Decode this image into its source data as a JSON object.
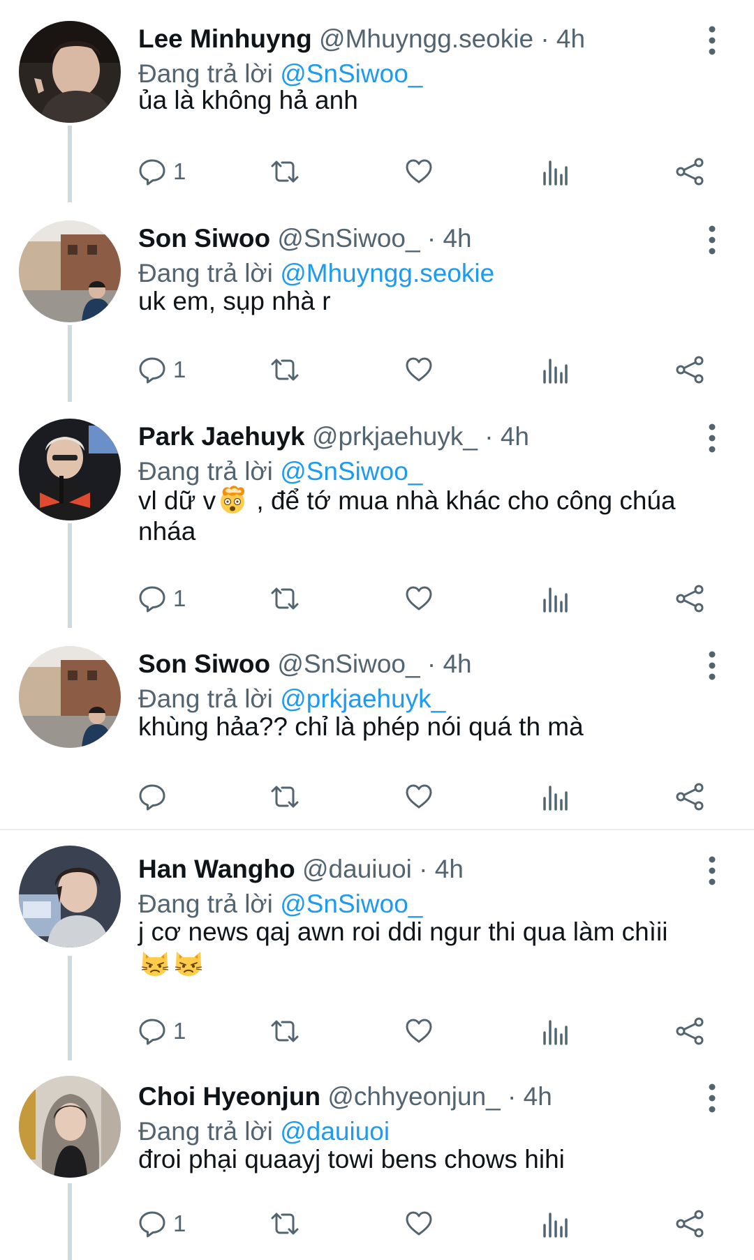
{
  "separator": "·",
  "tweets": [
    {
      "display_name": "Lee Minhuyng",
      "handle": "@Mhuyngg.seokie",
      "time": "4h",
      "replying_label": "Đang trả lời",
      "replying_to": "@SnSiwoo_",
      "text": "ủa là không hả anh",
      "reply_count": "1"
    },
    {
      "display_name": "Son Siwoo",
      "handle": "@SnSiwoo_",
      "time": "4h",
      "replying_label": "Đang trả lời",
      "replying_to": "@Mhuyngg.seokie",
      "text": "uk em, sụp nhà r",
      "reply_count": "1"
    },
    {
      "display_name": "Park Jaehuyk",
      "handle": "@prkjaehuyk_",
      "time": "4h",
      "replying_label": "Đang trả lời",
      "replying_to": "@SnSiwoo_",
      "text_before_emoji": "vl dữ v",
      "text_after_emoji": " , để tớ mua nhà khác cho công chúa nháa",
      "emoji": "exploding-head",
      "reply_count": "1"
    },
    {
      "display_name": "Son Siwoo",
      "handle": "@SnSiwoo_",
      "time": "4h",
      "replying_label": "Đang trả lời",
      "replying_to": "@prkjaehuyk_",
      "text": "khùng hảa?? chỉ là phép nói quá th mà",
      "reply_count": ""
    },
    {
      "display_name": "Han Wangho",
      "handle": "@dauiuoi",
      "time": "4h",
      "replying_label": "Đang trả lời",
      "replying_to": "@SnSiwoo_",
      "text": "j cơ news qaj awn roi ddi ngur thi qua làm chìii",
      "emoji": "pouting-cat",
      "reply_count": "1"
    },
    {
      "display_name": "Choi Hyeonjun",
      "handle": "@chhyeonjun_",
      "time": "4h",
      "replying_label": "Đang trả lời",
      "replying_to": "@dauiuoi",
      "text": "đroi phại quaayj towi bens chows hihi",
      "reply_count": "1"
    }
  ],
  "colors": {
    "link": "#1d9bf0",
    "secondary_text": "#536471",
    "thread_line": "#cfd9de"
  },
  "icons": [
    "reply-icon",
    "retweet-icon",
    "like-icon",
    "views-icon",
    "share-icon",
    "more-icon"
  ]
}
